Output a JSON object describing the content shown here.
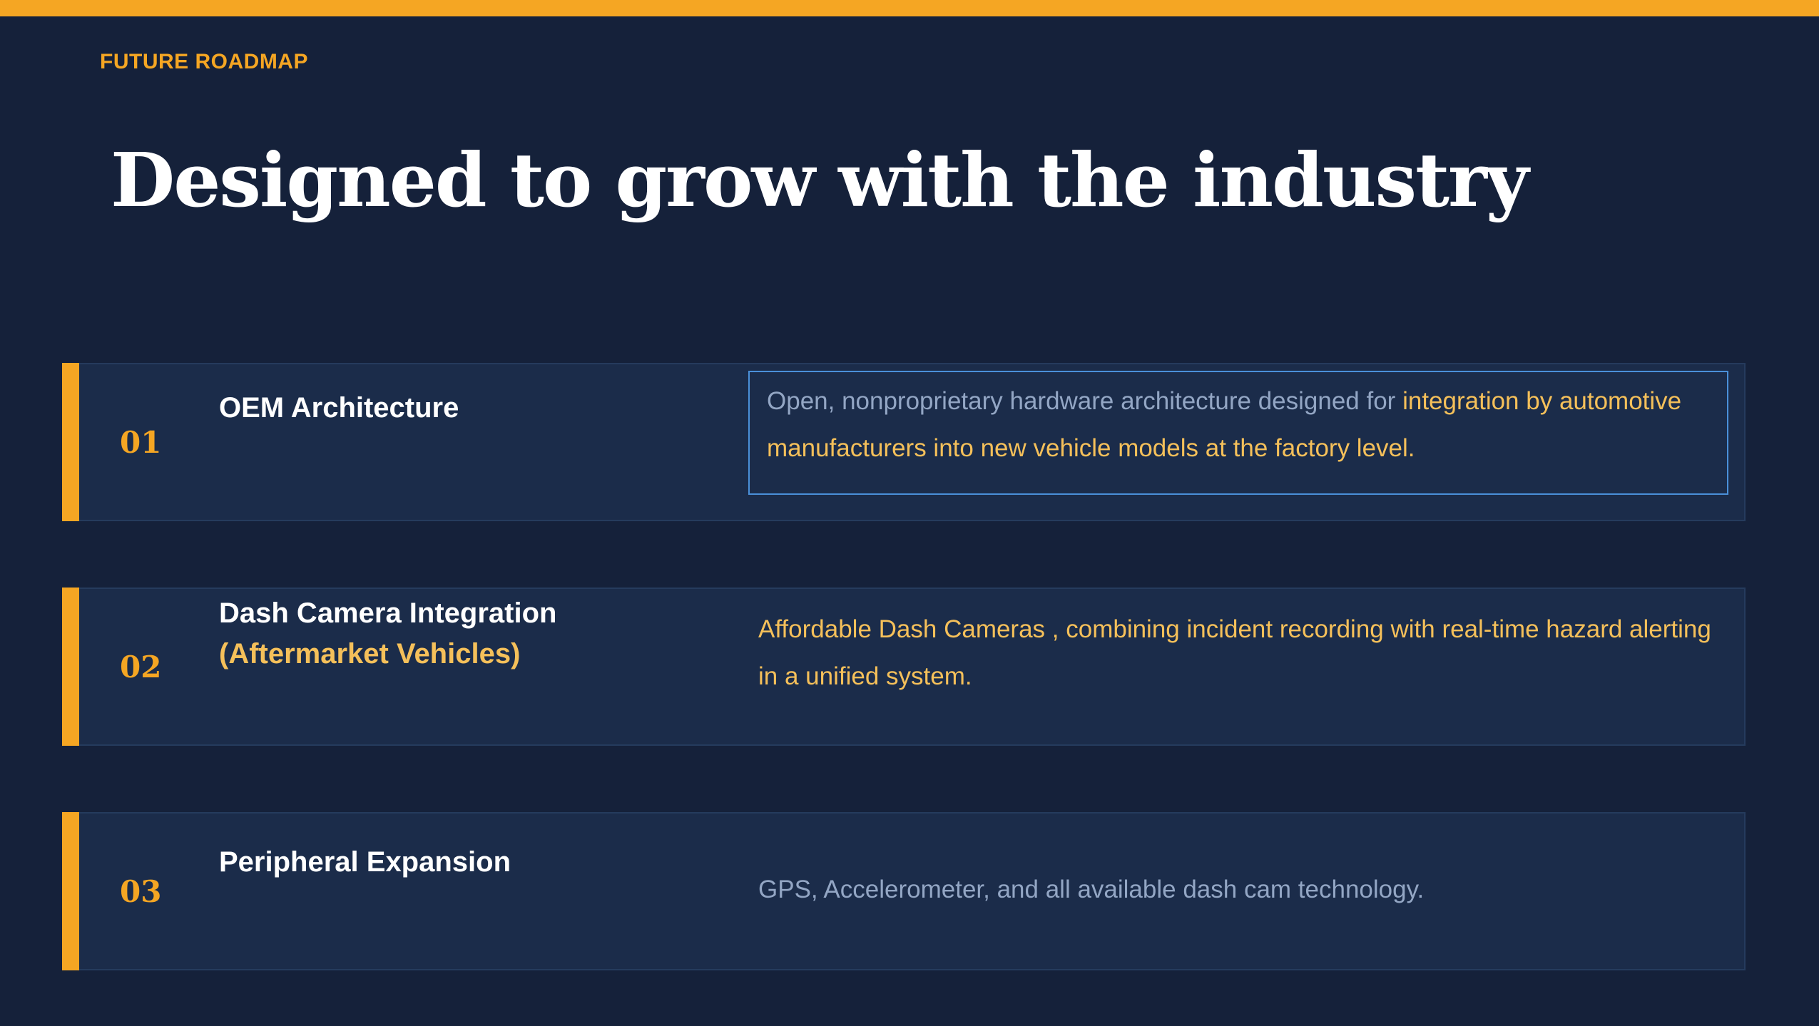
{
  "eyebrow": "FUTURE ROADMAP",
  "headline": "Designed to grow with the industry",
  "colors": {
    "accent": "#f5a623",
    "background": "#15213a",
    "card": "#1b2c4a",
    "highlight_text": "#f5c05a",
    "muted_text": "#93a6c4",
    "focus_border": "#4a90d9"
  },
  "items": [
    {
      "number": "01",
      "title": "OEM Architecture",
      "desc_plain": "Open, nonproprietary hardware architecture designed for ",
      "desc_highlight": "integration by automotive manufacturers into new vehicle models at the factory level."
    },
    {
      "number": "02",
      "title": "Dash Camera Integration",
      "subtitle": "(Aftermarket Vehicles)",
      "desc": "Affordable Dash Cameras , combining incident recording with real-time hazard alerting in a unified system."
    },
    {
      "number": "03",
      "title": "Peripheral Expansion",
      "desc": "GPS, Accelerometer, and all available dash cam technology."
    }
  ]
}
